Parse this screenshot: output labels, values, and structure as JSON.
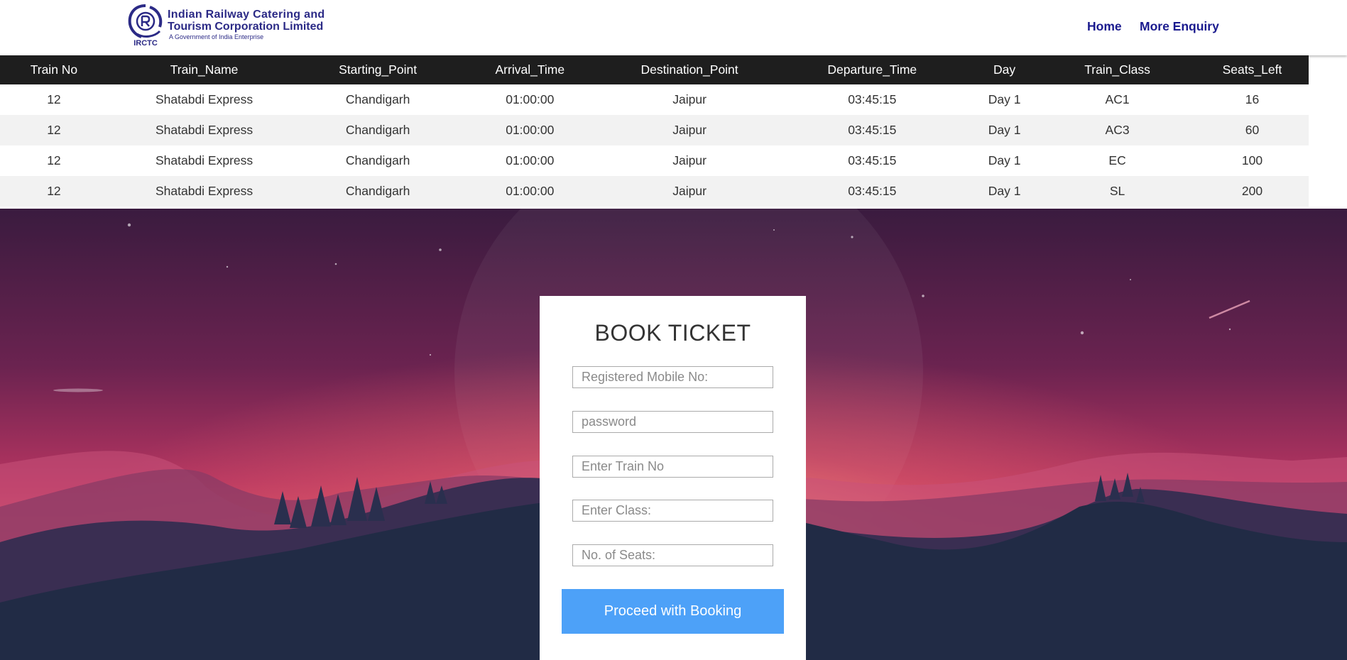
{
  "header": {
    "brand_line1": "Indian Railway Catering and",
    "brand_line2": "Tourism Corporation Limited",
    "brand_sub": "A Government of India Enterprise",
    "logo_text": "IRCTC",
    "nav": {
      "home": "Home",
      "more_enquiry": "More Enquiry"
    },
    "brand_color": "#2b2a86"
  },
  "table": {
    "columns": [
      "Train No",
      "Train_Name",
      "Starting_Point",
      "Arrival_Time",
      "Destination_Point",
      "Departure_Time",
      "Day",
      "Train_Class",
      "Seats_Left"
    ],
    "rows": [
      [
        "12",
        "Shatabdi Express",
        "Chandigarh",
        "01:00:00",
        "Jaipur",
        "03:45:15",
        "Day 1",
        "AC1",
        "16"
      ],
      [
        "12",
        "Shatabdi Express",
        "Chandigarh",
        "01:00:00",
        "Jaipur",
        "03:45:15",
        "Day 1",
        "AC3",
        "60"
      ],
      [
        "12",
        "Shatabdi Express",
        "Chandigarh",
        "01:00:00",
        "Jaipur",
        "03:45:15",
        "Day 1",
        "EC",
        "100"
      ],
      [
        "12",
        "Shatabdi Express",
        "Chandigarh",
        "01:00:00",
        "Jaipur",
        "03:45:15",
        "Day 1",
        "SL",
        "200"
      ]
    ]
  },
  "form": {
    "title": "BOOK TICKET",
    "fields": [
      {
        "name": "mobile-input",
        "placeholder": "Registered Mobile No:",
        "value": ""
      },
      {
        "name": "password-input",
        "placeholder": "password",
        "value": ""
      },
      {
        "name": "train-no-input",
        "placeholder": "Enter Train No",
        "value": ""
      },
      {
        "name": "class-input",
        "placeholder": "Enter Class:",
        "value": ""
      },
      {
        "name": "seats-input",
        "placeholder": "No. of Seats:",
        "value": ""
      }
    ],
    "submit_label": "Proceed with Booking",
    "accent_color": "#4da1f8"
  }
}
